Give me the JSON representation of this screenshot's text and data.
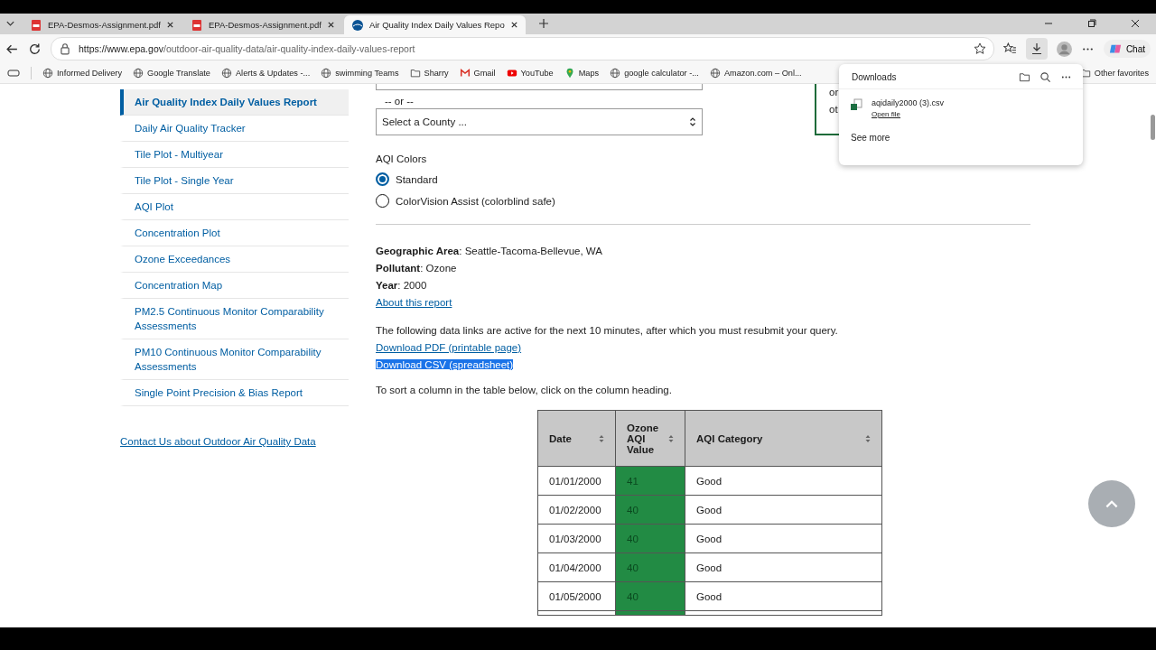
{
  "tabs": [
    {
      "title": "EPA-Desmos-Assignment.pdf",
      "kind": "pdf",
      "selected": false
    },
    {
      "title": "EPA-Desmos-Assignment.pdf",
      "kind": "pdf",
      "selected": false
    },
    {
      "title": "Air Quality Index Daily Values Repo",
      "kind": "site",
      "selected": true
    }
  ],
  "address_bar": {
    "url_host": "https://www.epa.gov",
    "url_path": "/outdoor-air-quality-data/air-quality-index-daily-values-report"
  },
  "toolbar": {
    "chat_label": "Chat"
  },
  "bookmarks": [
    {
      "label": "Informed Delivery",
      "kind": "globe"
    },
    {
      "label": "Google Translate",
      "kind": "globe"
    },
    {
      "label": "Alerts & Updates -...",
      "kind": "globe"
    },
    {
      "label": "swimming Teams",
      "kind": "globe"
    },
    {
      "label": "Sharry",
      "kind": "folder"
    },
    {
      "label": "Gmail",
      "kind": "gmail"
    },
    {
      "label": "YouTube",
      "kind": "youtube"
    },
    {
      "label": "Maps",
      "kind": "maps"
    },
    {
      "label": "google calculator -...",
      "kind": "globe"
    },
    {
      "label": "Amazon.com – Onl...",
      "kind": "globe"
    }
  ],
  "other_favorites": "Other favorites",
  "sidebar": {
    "items": [
      {
        "label": "Air Quality Index Daily Values Report",
        "selected": true
      },
      {
        "label": "Daily Air Quality Tracker",
        "selected": false
      },
      {
        "label": "Tile Plot - Multiyear",
        "selected": false
      },
      {
        "label": "Tile Plot - Single Year",
        "selected": false
      },
      {
        "label": "AQI Plot",
        "selected": false
      },
      {
        "label": "Concentration Plot",
        "selected": false
      },
      {
        "label": "Ozone Exceedances",
        "selected": false
      },
      {
        "label": "Concentration Map",
        "selected": false
      },
      {
        "label": "PM2.5 Continuous Monitor Comparability Assessments",
        "selected": false
      },
      {
        "label": "PM10 Continuous Monitor Comparability Assessments",
        "selected": false
      },
      {
        "label": "Single Point Precision & Bias Report",
        "selected": false
      }
    ],
    "contact_link": "Contact Us about Outdoor Air Quality Data"
  },
  "form": {
    "or_text": "-- or --",
    "county_select": "Select a County ...",
    "aqi_colors_label": "AQI Colors",
    "aqi_colors": [
      {
        "label": "Standard",
        "selected": true
      },
      {
        "label": "ColorVision Assist (colorblind safe)",
        "selected": false
      }
    ]
  },
  "side_box": {
    "lines": [
      "or",
      "ot"
    ]
  },
  "report": {
    "fields": [
      {
        "name": "Geographic Area",
        "value": ": Seattle-Tacoma-Bellevue, WA"
      },
      {
        "name": "Pollutant",
        "value": ": Ozone"
      },
      {
        "name": "Year",
        "value": ": 2000"
      }
    ],
    "about_link": "About this report",
    "notice": "The following data links are active for the next 10 minutes, after which you must resubmit your query.",
    "pdf_link": "Download PDF (printable page)",
    "csv_link": "Download CSV (spreadsheet)",
    "sort_hint": "To sort a column in the table below, click on the column heading."
  },
  "table": {
    "columns": [
      "Date",
      "Ozone AQI Value",
      "AQI Category"
    ],
    "rows": [
      {
        "date": "01/01/2000",
        "value": "41",
        "category": "Good",
        "color": "#228b44"
      },
      {
        "date": "01/02/2000",
        "value": "40",
        "category": "Good",
        "color": "#228b44"
      },
      {
        "date": "01/03/2000",
        "value": "40",
        "category": "Good",
        "color": "#228b44"
      },
      {
        "date": "01/04/2000",
        "value": "40",
        "category": "Good",
        "color": "#228b44"
      },
      {
        "date": "01/05/2000",
        "value": "40",
        "category": "Good",
        "color": "#228b44"
      }
    ]
  },
  "downloads": {
    "title": "Downloads",
    "file": "aqidaily2000 (3).csv",
    "open_file": "Open file",
    "see_more": "See more"
  }
}
